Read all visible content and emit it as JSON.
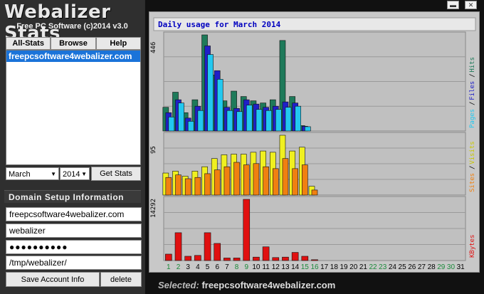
{
  "app": {
    "title": "Webalizer Stats",
    "subtitle": "Free PC Software (c)2014 v3.0"
  },
  "tabs": [
    "All-Stats",
    "Browse",
    "Help"
  ],
  "sites": [
    "freepcsoftware4webalizer.com"
  ],
  "period": {
    "month": "March",
    "year": "2014",
    "button": "Get Stats"
  },
  "domain_setup": {
    "heading": "Domain Setup Information",
    "domain": "freepcsoftware4webalizer.com",
    "user": "webalizer",
    "password": "●●●●●●●●●●",
    "path": "/tmp/webalizer/",
    "save_label": "Save Account Info",
    "delete_label": "delete"
  },
  "status": {
    "label": "Selected:",
    "value": "freepcsoftware4webalizer.com"
  },
  "chart_data": {
    "type": "bar",
    "title": "Daily usage for March 2014",
    "x": [
      1,
      2,
      3,
      4,
      5,
      6,
      7,
      8,
      9,
      10,
      11,
      12,
      13,
      14,
      15,
      16,
      17,
      18,
      19,
      20,
      21,
      22,
      23,
      24,
      25,
      26,
      27,
      28,
      29,
      30,
      31
    ],
    "weekend_days": [
      1,
      2,
      8,
      9,
      15,
      16,
      22,
      23,
      29,
      30
    ],
    "colors": {
      "hits": "#1e7a5a",
      "files": "#2020c8",
      "pages": "#22c8f0",
      "visits": "#f0f020",
      "sites": "#f08010",
      "kbytes": "#e01010",
      "title": "#0000c0",
      "weekend": "#1a8a3a"
    },
    "panels": [
      {
        "name": "hits_files_pages",
        "max_label": "446",
        "ymax": 446,
        "legend": [
          "Pages",
          "/",
          "Files",
          "/",
          "Hits"
        ],
        "series": [
          {
            "name": "Hits",
            "values": [
              110,
              180,
              85,
              145,
              446,
              260,
              140,
              185,
              160,
              140,
              130,
              145,
              420,
              160,
              25,
              0,
              0,
              0,
              0,
              0,
              0,
              0,
              0,
              0,
              0,
              0,
              0,
              0,
              0,
              0,
              0
            ]
          },
          {
            "name": "Files",
            "values": [
              85,
              145,
              60,
              115,
              395,
              280,
              110,
              105,
              145,
              125,
              110,
              115,
              135,
              130,
              22,
              0,
              0,
              0,
              0,
              0,
              0,
              0,
              0,
              0,
              0,
              0,
              0,
              0,
              0,
              0,
              0
            ]
          },
          {
            "name": "Pages",
            "values": [
              65,
              130,
              45,
              95,
              355,
              240,
              95,
              90,
              120,
              100,
              95,
              100,
              110,
              115,
              20,
              0,
              0,
              0,
              0,
              0,
              0,
              0,
              0,
              0,
              0,
              0,
              0,
              0,
              0,
              0,
              0
            ]
          }
        ]
      },
      {
        "name": "visits_sites",
        "max_label": "95",
        "ymax": 95,
        "legend": [
          "Sites",
          "/",
          "Visits"
        ],
        "series": [
          {
            "name": "Visits",
            "values": [
              35,
              38,
              30,
              38,
              45,
              58,
              64,
              65,
              65,
              68,
              70,
              68,
              95,
              70,
              76,
              14,
              0,
              0,
              0,
              0,
              0,
              0,
              0,
              0,
              0,
              0,
              0,
              0,
              0,
              0,
              0
            ]
          },
          {
            "name": "Sites",
            "values": [
              28,
              32,
              26,
              28,
              34,
              40,
              45,
              52,
              48,
              50,
              45,
              42,
              58,
              42,
              48,
              8,
              0,
              0,
              0,
              0,
              0,
              0,
              0,
              0,
              0,
              0,
              0,
              0,
              0,
              0,
              0
            ]
          }
        ]
      },
      {
        "name": "kbytes",
        "max_label": "14292",
        "ymax": 14292,
        "legend": [
          "KBytes"
        ],
        "series": [
          {
            "name": "KBytes",
            "values": [
              1500,
              6500,
              1000,
              1200,
              6500,
              4000,
              600,
              600,
              14292,
              800,
              3200,
              700,
              800,
              1900,
              1000,
              200,
              0,
              0,
              0,
              0,
              0,
              0,
              0,
              0,
              0,
              0,
              0,
              0,
              0,
              0,
              0
            ]
          }
        ]
      }
    ]
  }
}
